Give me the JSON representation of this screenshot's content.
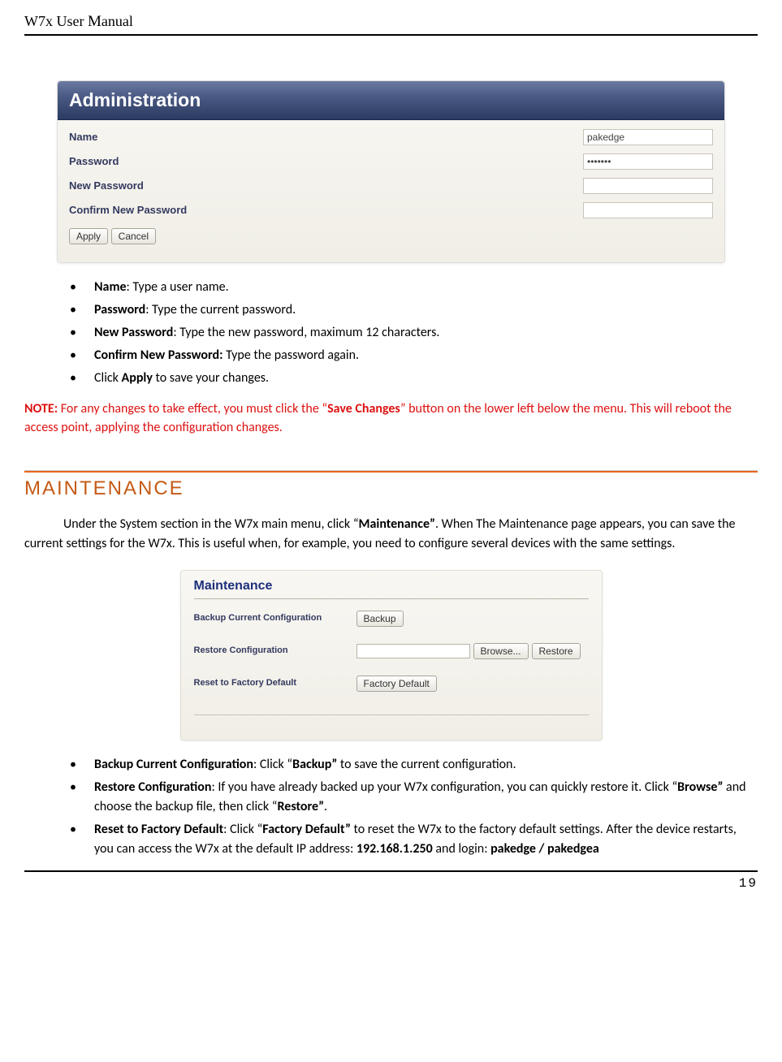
{
  "header": {
    "title_prefix": "W7x  User ",
    "title_m": "M",
    "title_suffix": "anual"
  },
  "admin": {
    "panel_title": "Administration",
    "rows": {
      "name_label": "Name",
      "name_value": "pakedge",
      "password_label": "Password",
      "password_value": "•••••••",
      "newpw_label": "New Password",
      "newpw_value": "",
      "confirm_label": "Confirm New Password",
      "confirm_value": ""
    },
    "apply_btn": "Apply",
    "cancel_btn": "Cancel"
  },
  "bullets1": {
    "b1a": "Name",
    "b1b": ": Type a user name.",
    "b2a": "Password",
    "b2b": ": Type the current password.",
    "b3a": "New Password",
    "b3b": ": Type the new password, maximum 12 characters.",
    "b4a": "Confirm New Password:",
    "b4b": " Type the password again.",
    "b5a": "Click ",
    "b5b": "Apply",
    "b5c": " to save your changes."
  },
  "note": {
    "pre": "NOTE:",
    "mid1": " For any changes to take effect, you must click the “",
    "bold": "Save Changes",
    "mid2": "” button on the lower left below the menu. This will reboot the access point, applying the configuration changes."
  },
  "section": {
    "title": "MAINTENANCE"
  },
  "para1": {
    "a": "Under the System section in the W7x main menu, click “",
    "b": "Maintenance”",
    "c": ". When The Maintenance page appears, you can save the current settings for the W7x. This is useful when, for example, you need to configure several devices with the same settings."
  },
  "maint": {
    "panel_title": "Maintenance",
    "r1_label": "Backup Current Configuration",
    "r1_btn": "Backup",
    "r2_label": "Restore Configuration",
    "r2_browse": "Browse...",
    "r2_restore": "Restore",
    "r3_label": "Reset to Factory Default",
    "r3_btn": "Factory Default"
  },
  "bullets2": {
    "b1a": "Backup Current Configuration",
    "b1b": ": Click “",
    "b1c": "Backup”",
    "b1d": " to save the current configuration.",
    "b2a": "Restore Configuration",
    "b2b": ": If you have already backed up your W7x configuration, you can quickly restore it. Click “",
    "b2c": "Browse”",
    "b2d": " and choose the backup file, then click “",
    "b2e": "Restore”",
    "b2f": ".",
    "b3a": "Reset to Factory Default",
    "b3b": ": Click “",
    "b3c": "Factory Default”",
    "b3d": " to reset the W7x to the factory default settings. After the device restarts, you can access the W7x at the default IP address: ",
    "b3e": "192.168.1.250",
    "b3f": " and login: ",
    "b3g": "pakedge / pakedgea"
  },
  "page_number": "19"
}
